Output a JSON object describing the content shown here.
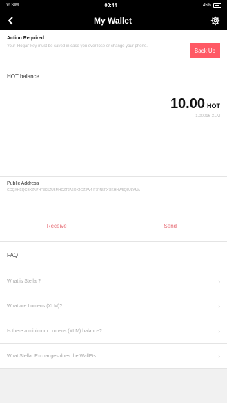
{
  "status": {
    "carrier": "no SIM",
    "time": "00:44",
    "battery": "45%"
  },
  "nav": {
    "title": "My Wallet",
    "back_icon": "chevron-left",
    "settings_icon": "gear"
  },
  "alert": {
    "heading": "Action Required",
    "description": "Your 'Hogar' key must be saved in case you ever lose or change your phone.",
    "button": "Back Up"
  },
  "balance": {
    "label": "HOT balance",
    "amount": "10.00",
    "unit": "HOT",
    "secondary": "1.00016 XLM"
  },
  "address": {
    "label": "Public Address",
    "value": "GCQXHEQGBXZN7HF3K5ZU5MHDZTJA6OXJGZ3W4-F7PN5FX7IKHHW5Q5ULYMA"
  },
  "actions": {
    "receive": "Receive",
    "send": "Send"
  },
  "faq": {
    "title": "FAQ",
    "items": [
      "What is Stellar?",
      "What are Lumens (XLM)?",
      "Is there a minimum Lumens (XLM) balance?",
      "What Stellar Exchanges does the WallEts"
    ]
  },
  "colors": {
    "accent": "#ff5965",
    "nav_bg": "#000000"
  }
}
